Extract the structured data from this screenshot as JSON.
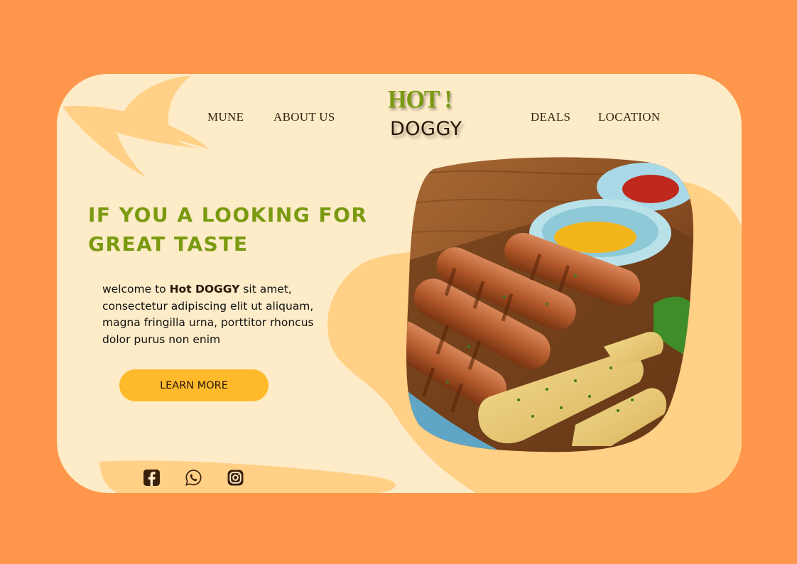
{
  "nav": {
    "left": [
      "MUNE",
      "ABOUT US"
    ],
    "right": [
      "DEALS",
      "LOCATION"
    ]
  },
  "logo": {
    "line1": "HOT !",
    "line2": "DOGGY"
  },
  "hero": {
    "headline_line1": "IF YOU A LOOKING FOR",
    "headline_line2": "GREAT TASTE",
    "body_prefix": "welcome to ",
    "body_brand": "Hot DOGGY",
    "body_suffix": " sit amet, consectetur adipiscing elit ut aliquam, magna fringilla urna, porttitor rhoncus dolor purus non enim",
    "cta_label": "LEARN MORE"
  },
  "social_icons": [
    "facebook-icon",
    "whatsapp-icon",
    "instagram-icon"
  ],
  "image": {
    "subject": "grilled sausages with mustard, ketchup and garlic bread"
  },
  "colors": {
    "background": "#FE974B",
    "card": "#FEEBC8",
    "blob": "#FFD085",
    "accent_green": "#7A9A10",
    "button": "#FEBA2A",
    "dark_brown": "#2a1608"
  }
}
